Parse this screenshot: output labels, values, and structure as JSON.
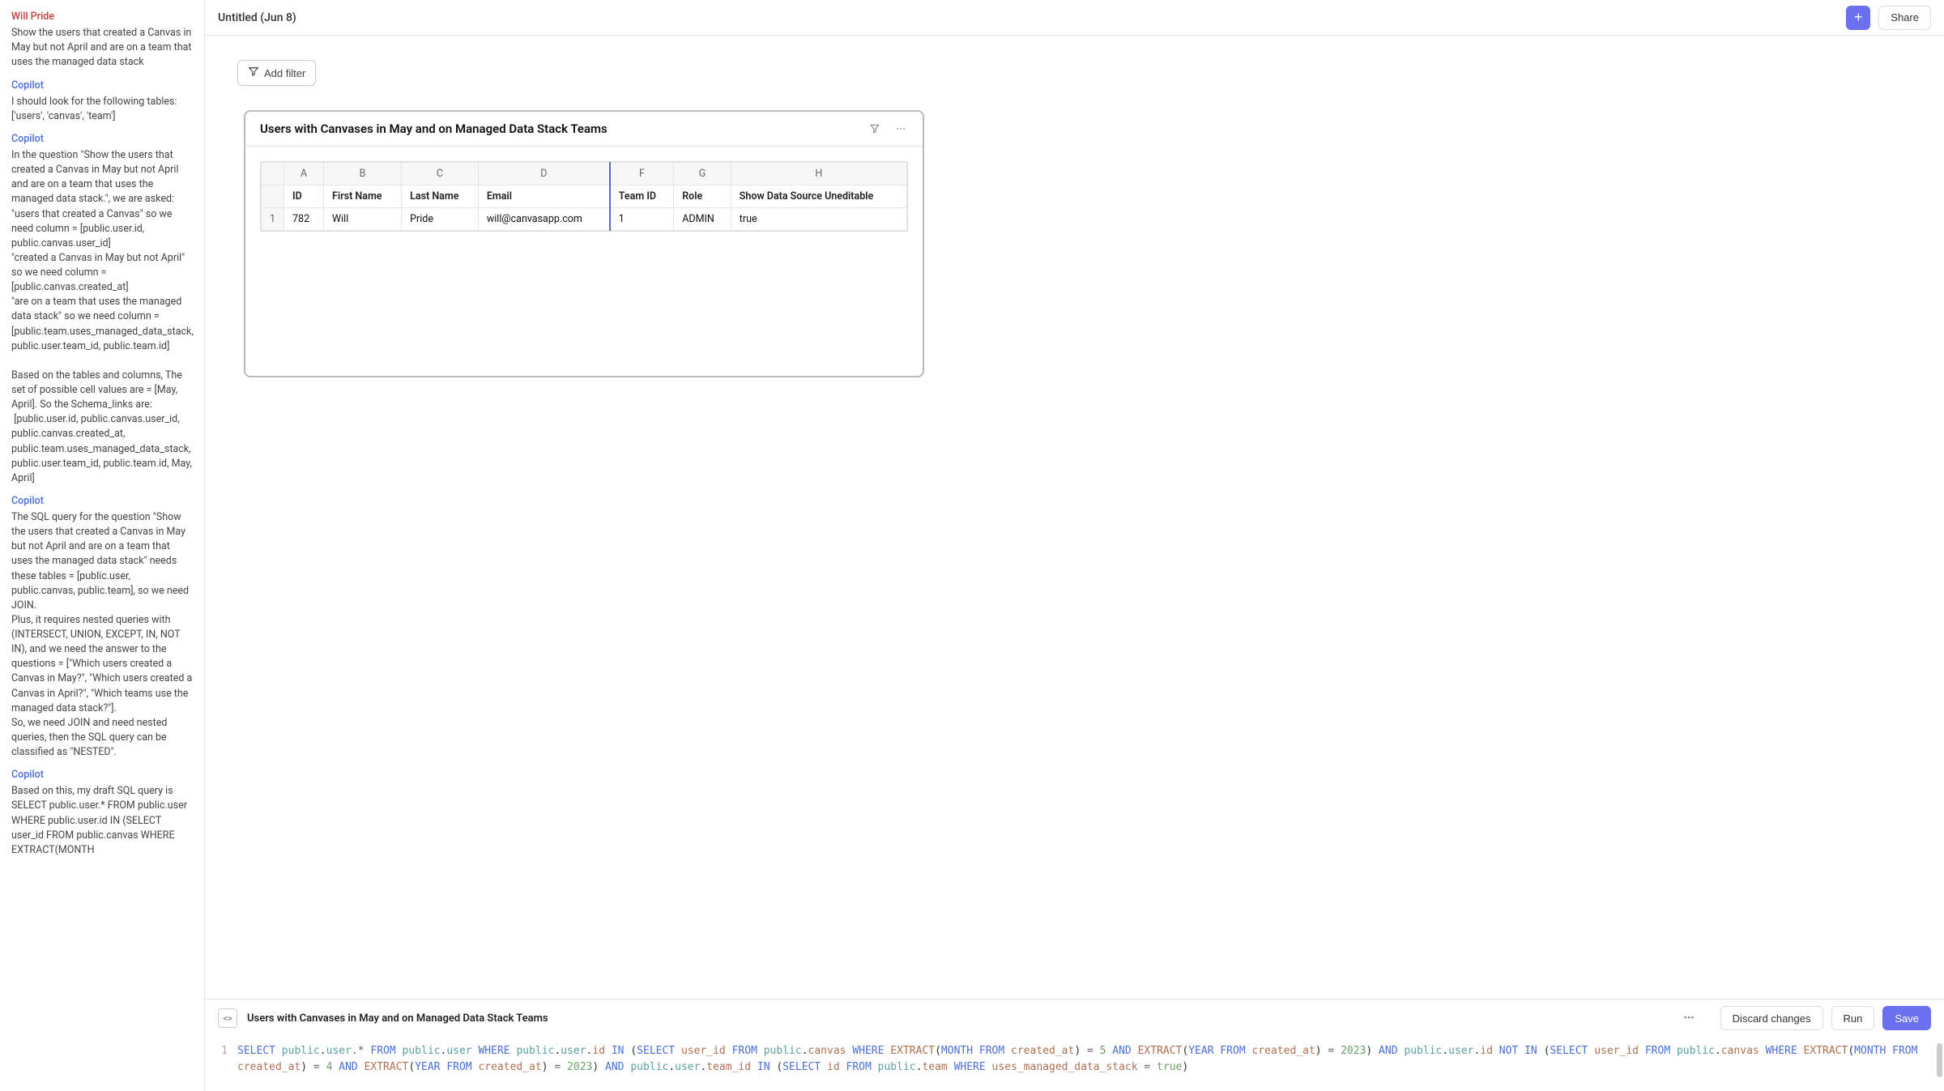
{
  "sidebar": {
    "messages": [
      {
        "author": "Will Pride",
        "authorClass": "author-user",
        "body": "Show the users that created a Canvas in May but not April and are on a team that uses the managed data stack"
      },
      {
        "author": "Copilot",
        "authorClass": "author-copilot",
        "body": "I should look for the following tables: ['users', 'canvas', 'team']"
      },
      {
        "author": "Copilot",
        "authorClass": "author-copilot",
        "body": "In the question \"Show the users that created a Canvas in May but not April and are on a team that uses the managed data stack.\", we are asked:\n\"users that created a Canvas\" so we need column = [public.user.id, public.canvas.user_id]\n\"created a Canvas in May but not April\" so we need column = [public.canvas.created_at]\n\"are on a team that uses the managed data stack\" so we need column = [public.team.uses_managed_data_stack, public.user.team_id, public.team.id]\n\nBased on the tables and columns, The set of possible cell values are = [May, April]. So the Schema_links are:\n [public.user.id, public.canvas.user_id, public.canvas.created_at, public.team.uses_managed_data_stack, public.user.team_id, public.team.id, May, April]"
      },
      {
        "author": "Copilot",
        "authorClass": "author-copilot",
        "body": "The SQL query for the question \"Show the users that created a Canvas in May but not April and are on a team that uses the managed data stack\" needs these tables = [public.user, public.canvas, public.team], so we need JOIN.\nPlus, it requires nested queries with (INTERSECT, UNION, EXCEPT, IN, NOT IN), and we need the answer to the questions = [\"Which users created a Canvas in May?\", \"Which users created a Canvas in April?\", \"Which teams use the managed data stack?\"].\nSo, we need JOIN and need nested queries, then the SQL query can be classified as \"NESTED\"."
      },
      {
        "author": "Copilot",
        "authorClass": "author-copilot",
        "body": "Based on this, my draft SQL query is SELECT public.user.* FROM public.user WHERE public.user.id IN (SELECT user_id FROM public.canvas WHERE EXTRACT(MONTH"
      }
    ]
  },
  "doc": {
    "title": "Untitled (Jun 8)"
  },
  "topbar": {
    "share": "Share"
  },
  "filterBar": {
    "addFilter": "Add filter"
  },
  "resultCard": {
    "title": "Users with Canvases in May and on Managed Data Stack Teams",
    "columns": [
      "A",
      "B",
      "C",
      "D",
      "F",
      "G",
      "H"
    ],
    "headers": [
      "ID",
      "First Name",
      "Last Name",
      "Email",
      "Team ID",
      "Role",
      "Show Data Source Uneditable"
    ],
    "rows": [
      {
        "n": "1",
        "cells": [
          "782",
          "Will",
          "Pride",
          "will@canvasapp.com",
          "1",
          "ADMIN",
          "true"
        ]
      }
    ]
  },
  "editor": {
    "title": "Users with Canvases in May and on Managed Data Stack Teams",
    "discard": "Discard changes",
    "run": "Run",
    "save": "Save",
    "sql_tokens": [
      {
        "t": "SELECT ",
        "c": "kw"
      },
      {
        "t": "public",
        "c": "ident"
      },
      {
        "t": ".",
        "c": "punct"
      },
      {
        "t": "user",
        "c": "ident"
      },
      {
        "t": ".* ",
        "c": "op"
      },
      {
        "t": "FROM ",
        "c": "kw"
      },
      {
        "t": "public",
        "c": "ident"
      },
      {
        "t": ".",
        "c": "punct"
      },
      {
        "t": "user",
        "c": "ident"
      },
      {
        "t": " WHERE ",
        "c": "kw"
      },
      {
        "t": "public",
        "c": "ident"
      },
      {
        "t": ".",
        "c": "punct"
      },
      {
        "t": "user",
        "c": "ident"
      },
      {
        "t": ".",
        "c": "punct"
      },
      {
        "t": "id",
        "c": "col"
      },
      {
        "t": " IN ",
        "c": "kw"
      },
      {
        "t": "(",
        "c": "punct"
      },
      {
        "t": "SELECT ",
        "c": "kw"
      },
      {
        "t": "user_id",
        "c": "col"
      },
      {
        "t": " FROM ",
        "c": "kw"
      },
      {
        "t": "public",
        "c": "ident"
      },
      {
        "t": ".",
        "c": "punct"
      },
      {
        "t": "canvas",
        "c": "col"
      },
      {
        "t": " WHERE ",
        "c": "kw"
      },
      {
        "t": "EXTRACT",
        "c": "col"
      },
      {
        "t": "(",
        "c": "punct"
      },
      {
        "t": "MONTH ",
        "c": "kw"
      },
      {
        "t": "FROM ",
        "c": "kw"
      },
      {
        "t": "created_at",
        "c": "col"
      },
      {
        "t": ")",
        "c": "punct"
      },
      {
        "t": " = ",
        "c": "op"
      },
      {
        "t": "5",
        "c": "num"
      },
      {
        "t": " AND ",
        "c": "kw"
      },
      {
        "t": "EXTRACT",
        "c": "col"
      },
      {
        "t": "(",
        "c": "punct"
      },
      {
        "t": "YEAR ",
        "c": "kw"
      },
      {
        "t": "FROM ",
        "c": "kw"
      },
      {
        "t": "created_at",
        "c": "col"
      },
      {
        "t": ")",
        "c": "punct"
      },
      {
        "t": " = ",
        "c": "op"
      },
      {
        "t": "2023",
        "c": "num"
      },
      {
        "t": ")",
        "c": "punct"
      },
      {
        "t": " AND ",
        "c": "kw"
      },
      {
        "t": "public",
        "c": "ident"
      },
      {
        "t": ".",
        "c": "punct"
      },
      {
        "t": "user",
        "c": "ident"
      },
      {
        "t": ".",
        "c": "punct"
      },
      {
        "t": "id",
        "c": "col"
      },
      {
        "t": " NOT ",
        "c": "kw"
      },
      {
        "t": "IN ",
        "c": "kw"
      },
      {
        "t": "(",
        "c": "punct"
      },
      {
        "t": "SELECT ",
        "c": "kw"
      },
      {
        "t": "user_id",
        "c": "col"
      },
      {
        "t": " FROM ",
        "c": "kw"
      },
      {
        "t": "public",
        "c": "ident"
      },
      {
        "t": ".",
        "c": "punct"
      },
      {
        "t": "canvas",
        "c": "col"
      },
      {
        "t": " WHERE ",
        "c": "kw"
      },
      {
        "t": "EXTRACT",
        "c": "col"
      },
      {
        "t": "(",
        "c": "punct"
      },
      {
        "t": "MONTH ",
        "c": "kw"
      },
      {
        "t": "FROM ",
        "c": "kw"
      },
      {
        "t": "created_at",
        "c": "col"
      },
      {
        "t": ")",
        "c": "punct"
      },
      {
        "t": " = ",
        "c": "op"
      },
      {
        "t": "4",
        "c": "num"
      },
      {
        "t": " AND ",
        "c": "kw"
      },
      {
        "t": "EXTRACT",
        "c": "col"
      },
      {
        "t": "(",
        "c": "punct"
      },
      {
        "t": "YEAR ",
        "c": "kw"
      },
      {
        "t": "FROM ",
        "c": "kw"
      },
      {
        "t": "created_at",
        "c": "col"
      },
      {
        "t": ")",
        "c": "punct"
      },
      {
        "t": " = ",
        "c": "op"
      },
      {
        "t": "2023",
        "c": "num"
      },
      {
        "t": ")",
        "c": "punct"
      },
      {
        "t": " AND ",
        "c": "kw"
      },
      {
        "t": "public",
        "c": "ident"
      },
      {
        "t": ".",
        "c": "punct"
      },
      {
        "t": "user",
        "c": "ident"
      },
      {
        "t": ".",
        "c": "punct"
      },
      {
        "t": "team_id",
        "c": "col"
      },
      {
        "t": " IN ",
        "c": "kw"
      },
      {
        "t": "(",
        "c": "punct"
      },
      {
        "t": "SELECT ",
        "c": "kw"
      },
      {
        "t": "id",
        "c": "col"
      },
      {
        "t": " FROM ",
        "c": "kw"
      },
      {
        "t": "public",
        "c": "ident"
      },
      {
        "t": ".",
        "c": "punct"
      },
      {
        "t": "team",
        "c": "col"
      },
      {
        "t": " WHERE ",
        "c": "kw"
      },
      {
        "t": "uses_managed_data_stack",
        "c": "col"
      },
      {
        "t": " = ",
        "c": "op"
      },
      {
        "t": "true",
        "c": "num"
      },
      {
        "t": ")",
        "c": "punct"
      }
    ]
  }
}
